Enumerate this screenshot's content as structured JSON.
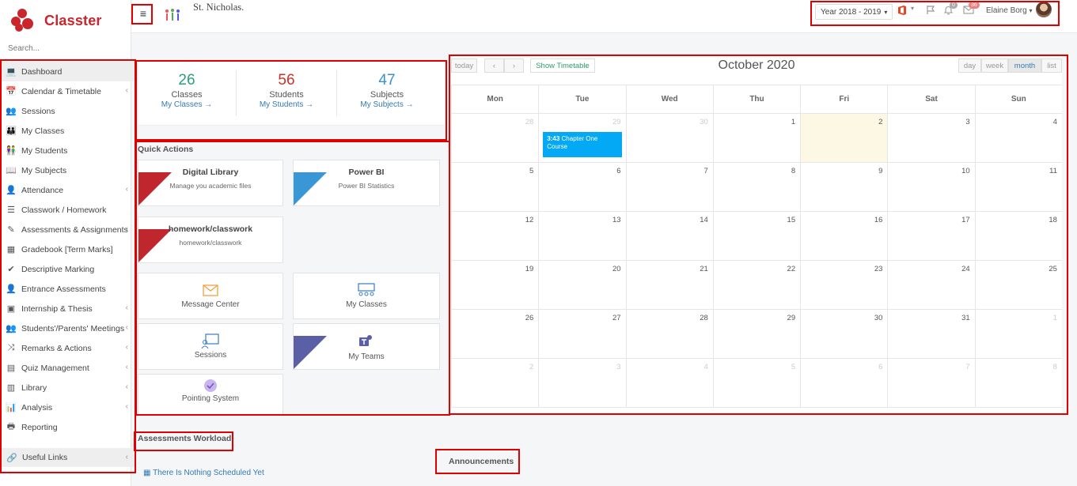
{
  "app": {
    "name": "Classter",
    "brand_color": "#c9252c"
  },
  "sidebar": {
    "search_placeholder": "Search...",
    "items": [
      {
        "label": "Dashboard",
        "icon": "laptop-icon",
        "glyph": "💻",
        "chevron": false,
        "active": true
      },
      {
        "label": "Calendar & Timetable",
        "icon": "calendar-icon",
        "glyph": "📅",
        "chevron": true
      },
      {
        "label": "Sessions",
        "icon": "sessions-icon",
        "glyph": "👥",
        "chevron": false
      },
      {
        "label": "My Classes",
        "icon": "classroom-icon",
        "glyph": "👪",
        "chevron": false
      },
      {
        "label": "My Students",
        "icon": "students-icon",
        "glyph": "👫",
        "chevron": false
      },
      {
        "label": "My Subjects",
        "icon": "book-icon",
        "glyph": "📖",
        "chevron": false
      },
      {
        "label": "Attendance",
        "icon": "attendance-icon",
        "glyph": "👤",
        "chevron": true
      },
      {
        "label": "Classwork / Homework",
        "icon": "list-icon",
        "glyph": "☰",
        "chevron": false
      },
      {
        "label": "Assessments & Assignments",
        "icon": "pencil-icon",
        "glyph": "✎",
        "chevron": true
      },
      {
        "label": "Gradebook [Term Marks]",
        "icon": "gradebook-icon",
        "glyph": "▦",
        "chevron": false
      },
      {
        "label": "Descriptive Marking",
        "icon": "marking-icon",
        "glyph": "✔",
        "chevron": false
      },
      {
        "label": "Entrance Assessments",
        "icon": "entrance-icon",
        "glyph": "👤",
        "chevron": false
      },
      {
        "label": "Internship & Thesis",
        "icon": "box-icon",
        "glyph": "▣",
        "chevron": true
      },
      {
        "label": "Students'/Parents' Meetings",
        "icon": "meeting-icon",
        "glyph": "👥",
        "chevron": true
      },
      {
        "label": "Remarks & Actions",
        "icon": "shuffle-icon",
        "glyph": "⤨",
        "chevron": true
      },
      {
        "label": "Quiz Management",
        "icon": "quiz-icon",
        "glyph": "▤",
        "chevron": true
      },
      {
        "label": "Library",
        "icon": "library-icon",
        "glyph": "▥",
        "chevron": true
      },
      {
        "label": "Analysis",
        "icon": "analysis-icon",
        "glyph": "📊",
        "chevron": true
      },
      {
        "label": "Reporting",
        "icon": "printer-icon",
        "glyph": "🖶",
        "chevron": false
      }
    ],
    "useful_links": "Useful Links"
  },
  "topbar": {
    "menu_glyph": "≡",
    "school_name": "St. Nicholas.",
    "year": "Year 2018 - 2019",
    "year_caret": "▾",
    "bell_badge": "0",
    "mail_badge": "36",
    "user_name": "Elaine Borg"
  },
  "stats": [
    {
      "value": "26",
      "label": "Classes",
      "link": "My Classes  →",
      "color": "#26a17b"
    },
    {
      "value": "56",
      "label": "Students",
      "link": "My Students  →",
      "color": "#c9302c"
    },
    {
      "value": "47",
      "label": "Subjects",
      "link": "My Subjects  →",
      "color": "#3a8fd0"
    }
  ],
  "quick_actions": {
    "title": "Quick Actions",
    "digital_library": {
      "title": "Digital Library",
      "sub": "Manage you academic files",
      "color": "#c0262d"
    },
    "power_bi": {
      "title": "Power BI",
      "sub": "Power BI Statistics",
      "color": "#3a97d6"
    },
    "homework": {
      "title": "homework/classwork",
      "sub": "homework/classwork",
      "color": "#c0262d"
    },
    "message_center": "Message Center",
    "my_classes": "My Classes",
    "sessions": "Sessions",
    "my_teams": {
      "label": "My Teams",
      "color": "#5b5fa6"
    },
    "pointing": "Pointing System"
  },
  "assessments": {
    "title": "Assessments Workload",
    "empty": "There Is Nothing Scheduled Yet"
  },
  "announcements": {
    "title": "Announcements"
  },
  "calendar": {
    "title": "October 2020",
    "today": "today",
    "prev": "‹",
    "next": "›",
    "show_timetable": "Show Timetable",
    "views": [
      "day",
      "week",
      "month",
      "list"
    ],
    "selected_view": "month",
    "days_of_week": [
      "Mon",
      "Tue",
      "Wed",
      "Thu",
      "Fri",
      "Sat",
      "Sun"
    ],
    "weeks": [
      [
        "28",
        "29",
        "30",
        "1",
        "2",
        "3",
        "4"
      ],
      [
        "5",
        "6",
        "7",
        "8",
        "9",
        "10",
        "11"
      ],
      [
        "12",
        "13",
        "14",
        "15",
        "16",
        "17",
        "18"
      ],
      [
        "19",
        "20",
        "21",
        "22",
        "23",
        "24",
        "25"
      ],
      [
        "26",
        "27",
        "28",
        "29",
        "30",
        "31",
        "1"
      ],
      [
        "2",
        "3",
        "4",
        "5",
        "6",
        "7",
        "8"
      ]
    ],
    "event": {
      "time": "3:43",
      "title": "Chapter One Course"
    }
  }
}
